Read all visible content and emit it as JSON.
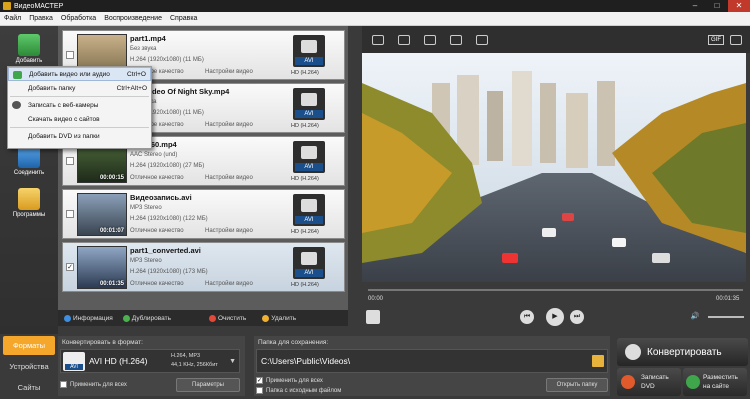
{
  "window": {
    "title": "ВидеоМАСТЕР",
    "min": "–",
    "max": "□",
    "close": "✕"
  },
  "menu": [
    "Файл",
    "Правка",
    "Обработка",
    "Воспроизведение",
    "Справка"
  ],
  "left_buttons": [
    {
      "label": "Добавить",
      "color": "#3fa64b"
    },
    {
      "label": "Соединить",
      "color": "#2f7fd0"
    },
    {
      "label": "Программы",
      "color": "#e8b33a"
    }
  ],
  "add_menu": {
    "items": [
      {
        "label": "Добавить видео или аудио",
        "shortcut": "Ctrl+O",
        "highlighted": true
      },
      {
        "label": "Добавить папку",
        "shortcut": "Ctrl+Alt+O"
      },
      {
        "label": "Записать с веб-камеры",
        "shortcut": ""
      },
      {
        "label": "Скачать видео с сайтов",
        "shortcut": ""
      },
      {
        "label": "Добавить DVD из папки",
        "shortcut": ""
      }
    ]
  },
  "files": [
    {
      "name": "part1.mp4",
      "audio": "Без звука",
      "video": "H.264 (1920x1080) (11 МБ)",
      "quality": "Отличное качество",
      "settings": "Настройки видео",
      "format": "AVI",
      "codec": "HD (H.264)",
      "duration": "",
      "checked": false,
      "selected": false
    },
    {
      "name": "pse Video Of Night Sky.mp4",
      "audio": "Без звука",
      "video": "H.264 (1920x1080) (11 МБ)",
      "quality": "Отличное качество",
      "settings": "Настройки видео",
      "format": "AVI",
      "codec": "HD (H.264)",
      "duration": "",
      "checked": false,
      "selected": false
    },
    {
      "name": "2519660.mp4",
      "audio": "AAC Stereo (und)",
      "video": "H.264 (1920x1080) (27 МБ)",
      "quality": "Отличное качество",
      "settings": "Настройки видео",
      "format": "AVI",
      "codec": "HD (H.264)",
      "duration": "00:00:15",
      "checked": false,
      "selected": false
    },
    {
      "name": "Видеозапись.avi",
      "audio": "MP3 Stereo",
      "video": "H.264 (1920x1080) (122 МБ)",
      "quality": "Отличное качество",
      "settings": "Настройки видео",
      "format": "AVI",
      "codec": "HD (H.264)",
      "duration": "00:01:07",
      "checked": false,
      "selected": false
    },
    {
      "name": "part1_converted.avi",
      "audio": "MP3 Stereo",
      "video": "H.264 (1920x1080) (173 МБ)",
      "quality": "Отличное качество",
      "settings": "Настройки видео",
      "format": "AVI",
      "codec": "HD (H.264)",
      "duration": "00:01:35",
      "checked": true,
      "selected": true
    }
  ],
  "actions": {
    "info": "Информация",
    "duplicate": "Дублировать",
    "clear": "Очистить",
    "delete": "Удалить"
  },
  "player": {
    "time_start": "00:00",
    "time_end": "00:01:35",
    "gif_label": "GIF"
  },
  "tabs": {
    "formats": "Форматы",
    "devices": "Устройства",
    "sites": "Сайты"
  },
  "format_panel": {
    "title": "Конвертировать в формат:",
    "format_name": "AVI HD (H.264)",
    "badge": "AVI",
    "line1": "H.264, MP3",
    "line2": "44,1 KHz, 256Кбит",
    "apply_all": "Применить для всех",
    "params": "Параметры"
  },
  "save_panel": {
    "title": "Папка для сохранения:",
    "path": "C:\\Users\\Public\\Videos\\",
    "apply_all": "Применить для всех",
    "source_folder": "Папка с исходным файлом",
    "open_folder": "Открыть папку"
  },
  "convert": {
    "label": "Конвертировать",
    "dvd": [
      "Записать",
      "DVD"
    ],
    "site": [
      "Разместить",
      "на сайте"
    ]
  }
}
